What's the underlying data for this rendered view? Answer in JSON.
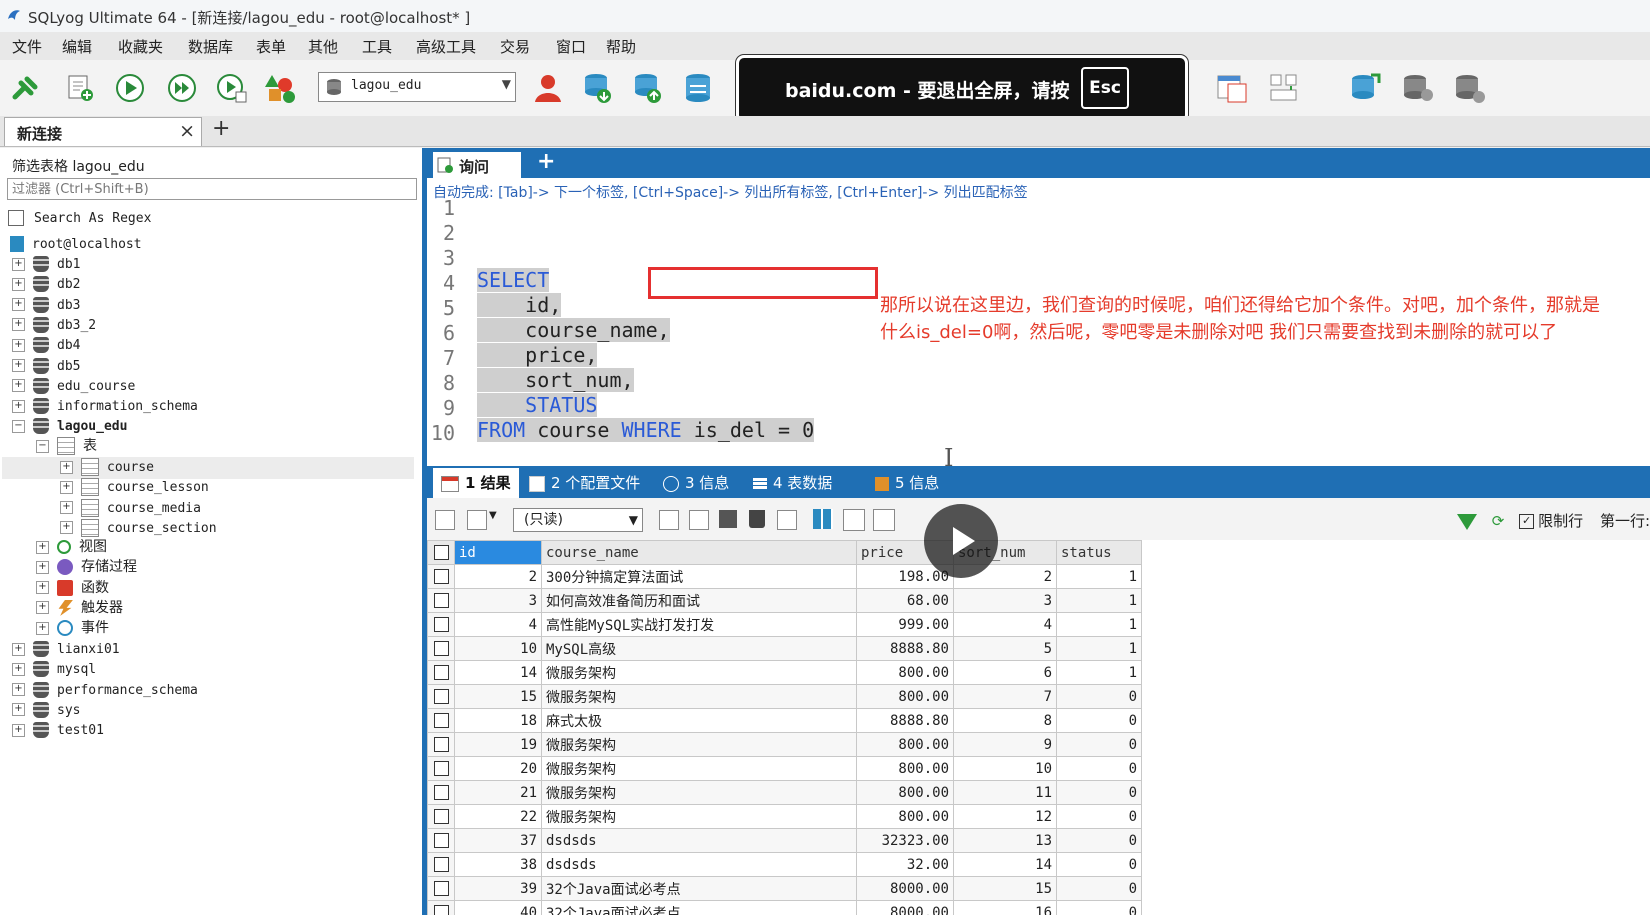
{
  "window": {
    "title": "SQLyog Ultimate 64 - [新连接/lagou_edu - root@localhost* ]"
  },
  "menu": [
    "文件",
    "编辑",
    "收藏夹",
    "数据库",
    "表单",
    "其他",
    "工具",
    "高级工具",
    "交易",
    "窗口",
    "帮助"
  ],
  "toolbar": {
    "db_select": "lagou_edu"
  },
  "fullscreen_banner": {
    "text": "baidu.com  -  要退出全屏，请按",
    "key": "Esc"
  },
  "connection_tab": {
    "label": "新连接",
    "close": "×",
    "add": "+"
  },
  "left": {
    "filter_label": "筛选表格 lagou_edu",
    "filter_placeholder": "过滤器 (Ctrl+Shift+B)",
    "regex_label": "Search As Regex",
    "root": "root@localhost",
    "dbs_top": [
      "db1",
      "db2",
      "db3",
      "db3_2",
      "db4",
      "db5",
      "edu_course",
      "information_schema"
    ],
    "active_db": "lagou_edu",
    "tables_folder": "表",
    "tables": [
      "course",
      "course_lesson",
      "course_media",
      "course_section"
    ],
    "objects": [
      "视图",
      "存储过程",
      "函数",
      "触发器",
      "事件"
    ],
    "dbs_bottom": [
      "lianxi01",
      "mysql",
      "performance_schema",
      "sys",
      "test01"
    ]
  },
  "query": {
    "tab_label": "询问",
    "add": "+",
    "autocomplete_hint": "自动完成: [Tab]-> 下一个标签, [Ctrl+Space]-> 列出所有标签, [Ctrl+Enter]-> 列出匹配标签",
    "line_numbers": [
      "1",
      "2",
      "3",
      "4",
      "5",
      "6",
      "7",
      "8",
      "9",
      "10"
    ],
    "lines": {
      "l4": "SELECT",
      "l5": "    id,",
      "l6": "    course_name,",
      "l7": "    price,",
      "l8": "    sort_num,",
      "l9": "    STATUS",
      "l10_from": "FROM",
      "l10_table": " course ",
      "l10_where": "WHERE",
      "l10_cond": " is_del = 0"
    }
  },
  "annotation": "那所以说在这里边，我们查询的时候呢，咱们还得给它加个条件。对吧，加个条件，那就是什么is_del=0啊，然后呢，零吧零是未删除对吧 我们只需要查找到未删除的就可以了",
  "result_tabs": [
    "1 结果",
    "2 个配置文件",
    "3 信息",
    "4 表数据",
    "5 信息"
  ],
  "result_toolbar": {
    "mode": "(只读)",
    "limit_label": "限制行",
    "first_row_label": "第一行:"
  },
  "columns": [
    "id",
    "course_name",
    "price",
    "sort_num",
    "status"
  ],
  "rows": [
    [
      "2",
      "300分钟搞定算法面试",
      "198.00",
      "2",
      "1"
    ],
    [
      "3",
      "如何高效准备简历和面试",
      "68.00",
      "3",
      "1"
    ],
    [
      "4",
      "高性能MySQL实战打发打发",
      "999.00",
      "4",
      "1"
    ],
    [
      "10",
      "MySQL高级",
      "8888.80",
      "5",
      "1"
    ],
    [
      "14",
      "微服务架构",
      "800.00",
      "6",
      "1"
    ],
    [
      "15",
      "微服务架构",
      "800.00",
      "7",
      "0"
    ],
    [
      "18",
      "麻式太极",
      "8888.80",
      "8",
      "0"
    ],
    [
      "19",
      "微服务架构",
      "800.00",
      "9",
      "0"
    ],
    [
      "20",
      "微服务架构",
      "800.00",
      "10",
      "0"
    ],
    [
      "21",
      "微服务架构",
      "800.00",
      "11",
      "0"
    ],
    [
      "22",
      "微服务架构",
      "800.00",
      "12",
      "0"
    ],
    [
      "37",
      "dsdsds",
      "32323.00",
      "13",
      "0"
    ],
    [
      "38",
      "dsdsds",
      "32.00",
      "14",
      "0"
    ],
    [
      "39",
      "32个Java面试必考点",
      "8000.00",
      "15",
      "0"
    ],
    [
      "40",
      "32个Java面试必考点",
      "8000.00",
      "16",
      "0"
    ]
  ],
  "colors": {
    "accent": "#1f6fb4",
    "keyword": "#2a5ad7",
    "annotation": "#e53b2b",
    "highlight_box": "#e53030"
  }
}
